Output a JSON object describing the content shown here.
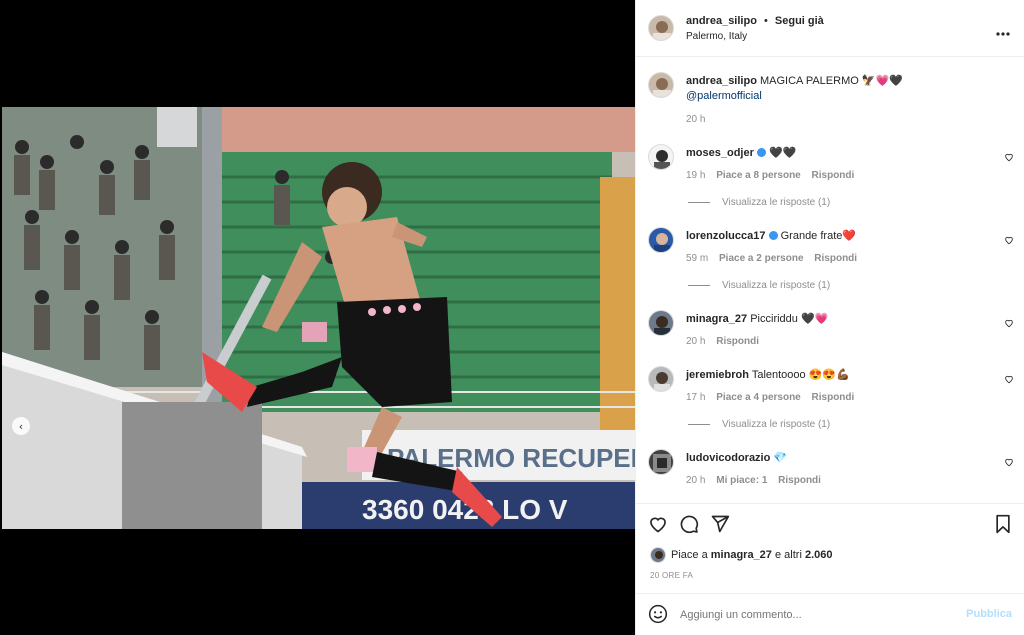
{
  "header": {
    "username": "andrea_silipo",
    "separator": "•",
    "follow_status": "Segui già",
    "location": "Palermo, Italy",
    "more_icon": "more-horizontal-icon"
  },
  "caption": {
    "username": "andrea_silipo",
    "text": "MAGICA PALERMO",
    "emoji": "🦅💗🖤",
    "mention": "@palermofficial",
    "time": "20 h"
  },
  "comments": [
    {
      "username": "moses_odjer",
      "verified": true,
      "text": "🖤🖤",
      "time": "19 h",
      "likes": "Piace a 8 persone",
      "reply": "Rispondi",
      "view_replies": "Visualizza le risposte (1)"
    },
    {
      "username": "lorenzolucca17",
      "verified": true,
      "text": "Grande frate❤️",
      "time": "59 m",
      "likes": "Piace a 2 persone",
      "reply": "Rispondi",
      "view_replies": "Visualizza le risposte (1)"
    },
    {
      "username": "minagra_27",
      "verified": false,
      "text": "Picciriddu 🖤💗",
      "time": "20 h",
      "likes": "",
      "reply": "Rispondi",
      "view_replies": ""
    },
    {
      "username": "jeremiebroh",
      "verified": false,
      "text": "Talentoooo 😍😍💪🏾",
      "time": "17 h",
      "likes": "Piace a 4 persone",
      "reply": "Rispondi",
      "view_replies": "Visualizza le risposte (1)"
    },
    {
      "username": "ludovicodorazio",
      "verified": false,
      "text": "💎",
      "time": "20 h",
      "likes": "Mi piace: 1",
      "reply": "Rispondi",
      "view_replies": ""
    }
  ],
  "actions": {
    "like_icon": "heart-icon",
    "comment_icon": "comment-icon",
    "share_icon": "paper-plane-icon",
    "save_icon": "bookmark-icon"
  },
  "likes": {
    "prefix": "Piace a",
    "user": "minagra_27",
    "suffix": "e altri",
    "count": "2.060"
  },
  "timestamp": "20 ORE FA",
  "add_comment": {
    "placeholder": "Aggiungi un commento...",
    "publish": "Pubblica",
    "emoji_icon": "smiley-icon"
  },
  "photo": {
    "banner_text": "PALERMO RECUPER",
    "ad_text": "3360 0423 LO V",
    "carousel_prev": "‹"
  },
  "colors": {
    "link": "#00376b",
    "verified": "#3897f0",
    "publish_disabled": "#b2dffc",
    "muted": "#8e8e8e"
  }
}
